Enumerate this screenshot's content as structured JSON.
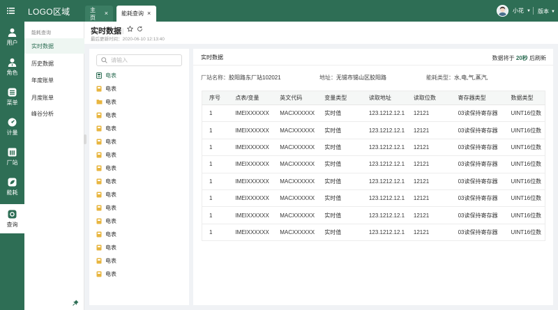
{
  "topbar": {
    "logo": "LOGO区域",
    "tabs": [
      {
        "label": "主页"
      },
      {
        "label": "能耗查询"
      }
    ],
    "user_name": "小花",
    "version_label": "版本"
  },
  "leftnav": {
    "items": [
      {
        "label": "用户",
        "icon": "user-icon"
      },
      {
        "label": "角色",
        "icon": "role-icon"
      },
      {
        "label": "菜单",
        "icon": "menu-icon"
      },
      {
        "label": "计量",
        "icon": "meter-icon"
      },
      {
        "label": "厂站",
        "icon": "station-icon"
      },
      {
        "label": "能耗",
        "icon": "energy-icon"
      },
      {
        "label": "查询",
        "icon": "query-icon",
        "active": true
      }
    ]
  },
  "submenu": {
    "title": "能耗查询",
    "items": [
      {
        "label": "实时数据",
        "active": true
      },
      {
        "label": "历史数据"
      },
      {
        "label": "年度账单"
      },
      {
        "label": "月度账单"
      },
      {
        "label": "峰谷分析"
      }
    ]
  },
  "header": {
    "title": "实时数据",
    "updated": "最后更新时间：2020-06-10 12:13:40"
  },
  "tree": {
    "search_placeholder": "请输入",
    "nodes": [
      {
        "label": "电表",
        "icon": "meter-node-icon",
        "active": true
      },
      {
        "label": "电表",
        "icon": "meter-file-icon"
      },
      {
        "label": "电表",
        "icon": "folder-icon"
      },
      {
        "label": "电表",
        "icon": "meter-file-icon"
      },
      {
        "label": "电表",
        "icon": "meter-file-icon"
      },
      {
        "label": "电表",
        "icon": "meter-file-icon"
      },
      {
        "label": "电表",
        "icon": "meter-file-icon"
      },
      {
        "label": "电表",
        "icon": "meter-file-icon"
      },
      {
        "label": "电表",
        "icon": "meter-file-icon"
      },
      {
        "label": "电表",
        "icon": "meter-file-icon"
      },
      {
        "label": "电表",
        "icon": "meter-file-icon"
      },
      {
        "label": "电表",
        "icon": "meter-file-icon"
      },
      {
        "label": "电表",
        "icon": "meter-file-icon"
      },
      {
        "label": "电表",
        "icon": "meter-file-icon"
      },
      {
        "label": "电表",
        "icon": "meter-file-icon"
      },
      {
        "label": "电表",
        "icon": "meter-file-icon"
      }
    ]
  },
  "panel": {
    "title": "实时数据",
    "refresh_prefix": "数据将于",
    "refresh_count": "20秒",
    "refresh_suffix": "后刷新",
    "station_label": "厂站名称：",
    "station_value": "胶阳路东厂站102021",
    "address_label": "地址：",
    "address_value": "无锡市锡山区胶阳路",
    "energy_label": "能耗类型：",
    "energy_value": "水,电,气,蒸汽,"
  },
  "table": {
    "headers": [
      "序号",
      "点表/变量",
      "英文代码",
      "变量类型",
      "读取地址",
      "读取位数",
      "寄存器类型",
      "数据类型"
    ],
    "rows": [
      [
        "1",
        "IMEIXXXXXX",
        "MACXXXXXX",
        "实时值",
        "123.1212.12.1",
        "12121",
        "03读保持寄存器",
        "UINT16位数"
      ],
      [
        "1",
        "IMEIXXXXXX",
        "MACXXXXXX",
        "实时值",
        "123.1212.12.1",
        "12121",
        "03读保持寄存器",
        "UINT16位数"
      ],
      [
        "1",
        "IMEIXXXXXX",
        "MACXXXXXX",
        "实时值",
        "123.1212.12.1",
        "12121",
        "03读保持寄存器",
        "UINT16位数"
      ],
      [
        "1",
        "IMEIXXXXXX",
        "MACXXXXXX",
        "实时值",
        "123.1212.12.1",
        "12121",
        "03读保持寄存器",
        "UINT16位数"
      ],
      [
        "1",
        "IMEIXXXXXX",
        "MACXXXXXX",
        "实时值",
        "123.1212.12.1",
        "12121",
        "03读保持寄存器",
        "UINT16位数"
      ],
      [
        "1",
        "IMEIXXXXXX",
        "MACXXXXXX",
        "实时值",
        "123.1212.12.1",
        "12121",
        "03读保持寄存器",
        "UINT16位数"
      ],
      [
        "1",
        "IMEIXXXXXX",
        "MACXXXXXX",
        "实时值",
        "123.1212.12.1",
        "12121",
        "03读保持寄存器",
        "UINT16位数"
      ],
      [
        "1",
        "IMEIXXXXXX",
        "MACXXXXXX",
        "实时值",
        "123.1212.12.1",
        "12121",
        "03读保持寄存器",
        "UINT16位数"
      ]
    ]
  },
  "colors": {
    "brand": "#2e6e55",
    "accent": "#2e6e55",
    "tree_icon": "#e8b640"
  }
}
